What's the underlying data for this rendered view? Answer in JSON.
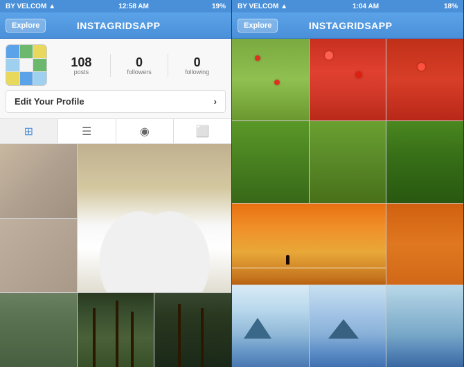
{
  "left_phone": {
    "status": {
      "carrier": "BY VELCOM",
      "time": "12:58 AM",
      "battery": "19%"
    },
    "nav": {
      "explore_label": "Explore",
      "title": "INSTAGRIDSAPP"
    },
    "profile": {
      "stats": [
        {
          "number": "108",
          "label": "posts"
        },
        {
          "number": "0",
          "label": "followers"
        },
        {
          "number": "0",
          "label": "following"
        }
      ],
      "edit_label": "Edit Your Profile"
    },
    "tabs": [
      {
        "icon": "⊞",
        "label": "grid-view",
        "active": true
      },
      {
        "icon": "≡",
        "label": "list-view",
        "active": false
      },
      {
        "icon": "📍",
        "label": "map-view",
        "active": false
      },
      {
        "icon": "👤",
        "label": "profile-view",
        "active": false
      }
    ]
  },
  "right_phone": {
    "status": {
      "carrier": "BY VELCOM",
      "time": "1:04 AM",
      "battery": "18%"
    },
    "nav": {
      "explore_label": "Explore",
      "title": "INSTAGRIDSAPP"
    }
  }
}
